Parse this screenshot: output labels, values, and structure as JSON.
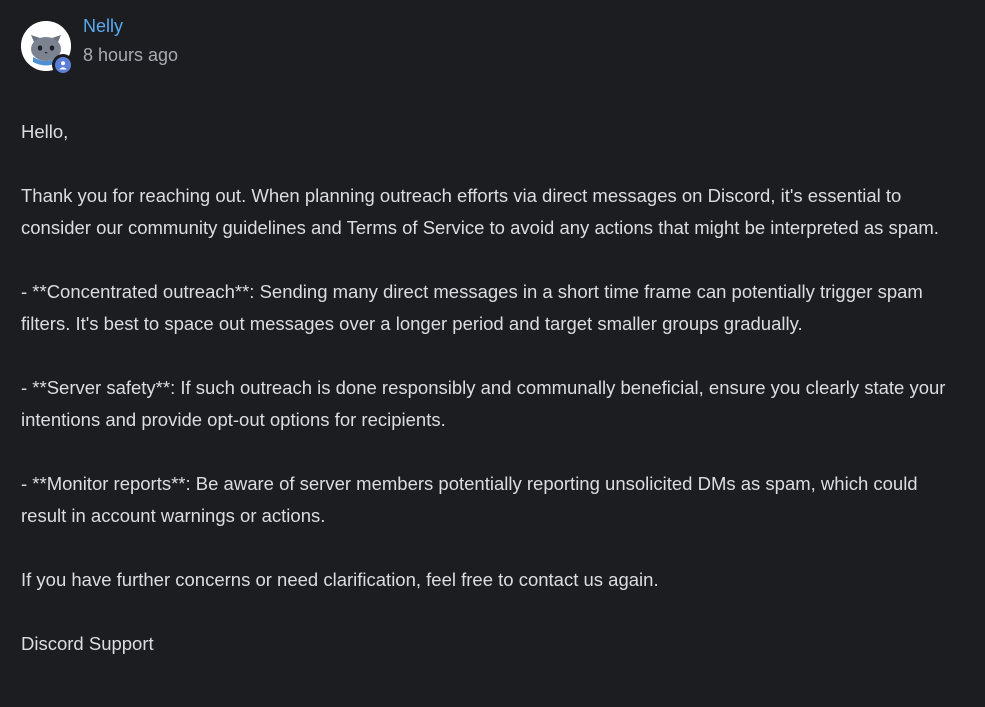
{
  "message": {
    "author": "Nelly",
    "timestamp": "8 hours ago",
    "avatar_icon": "cat-avatar-icon",
    "badge_icon": "user-status-icon",
    "accent_color": "#5aa9f0",
    "paragraphs": [
      "Hello,",
      "Thank you for reaching out. When planning outreach efforts via direct messages on Discord, it's essential to consider our community guidelines and Terms of Service to avoid any actions that might be interpreted as spam.",
      "- **Concentrated outreach**: Sending many direct messages in a short time frame can potentially trigger spam filters. It's best to space out messages over a longer period and target smaller groups gradually.",
      "- **Server safety**: If such outreach is done responsibly and communally beneficial, ensure you clearly state your intentions and provide opt-out options for recipients.",
      "- **Monitor reports**: Be aware of server members potentially reporting unsolicited DMs as spam, which could result in account warnings or actions.",
      "If you have further concerns or need clarification, feel free to contact us again.",
      "Discord Support"
    ]
  }
}
